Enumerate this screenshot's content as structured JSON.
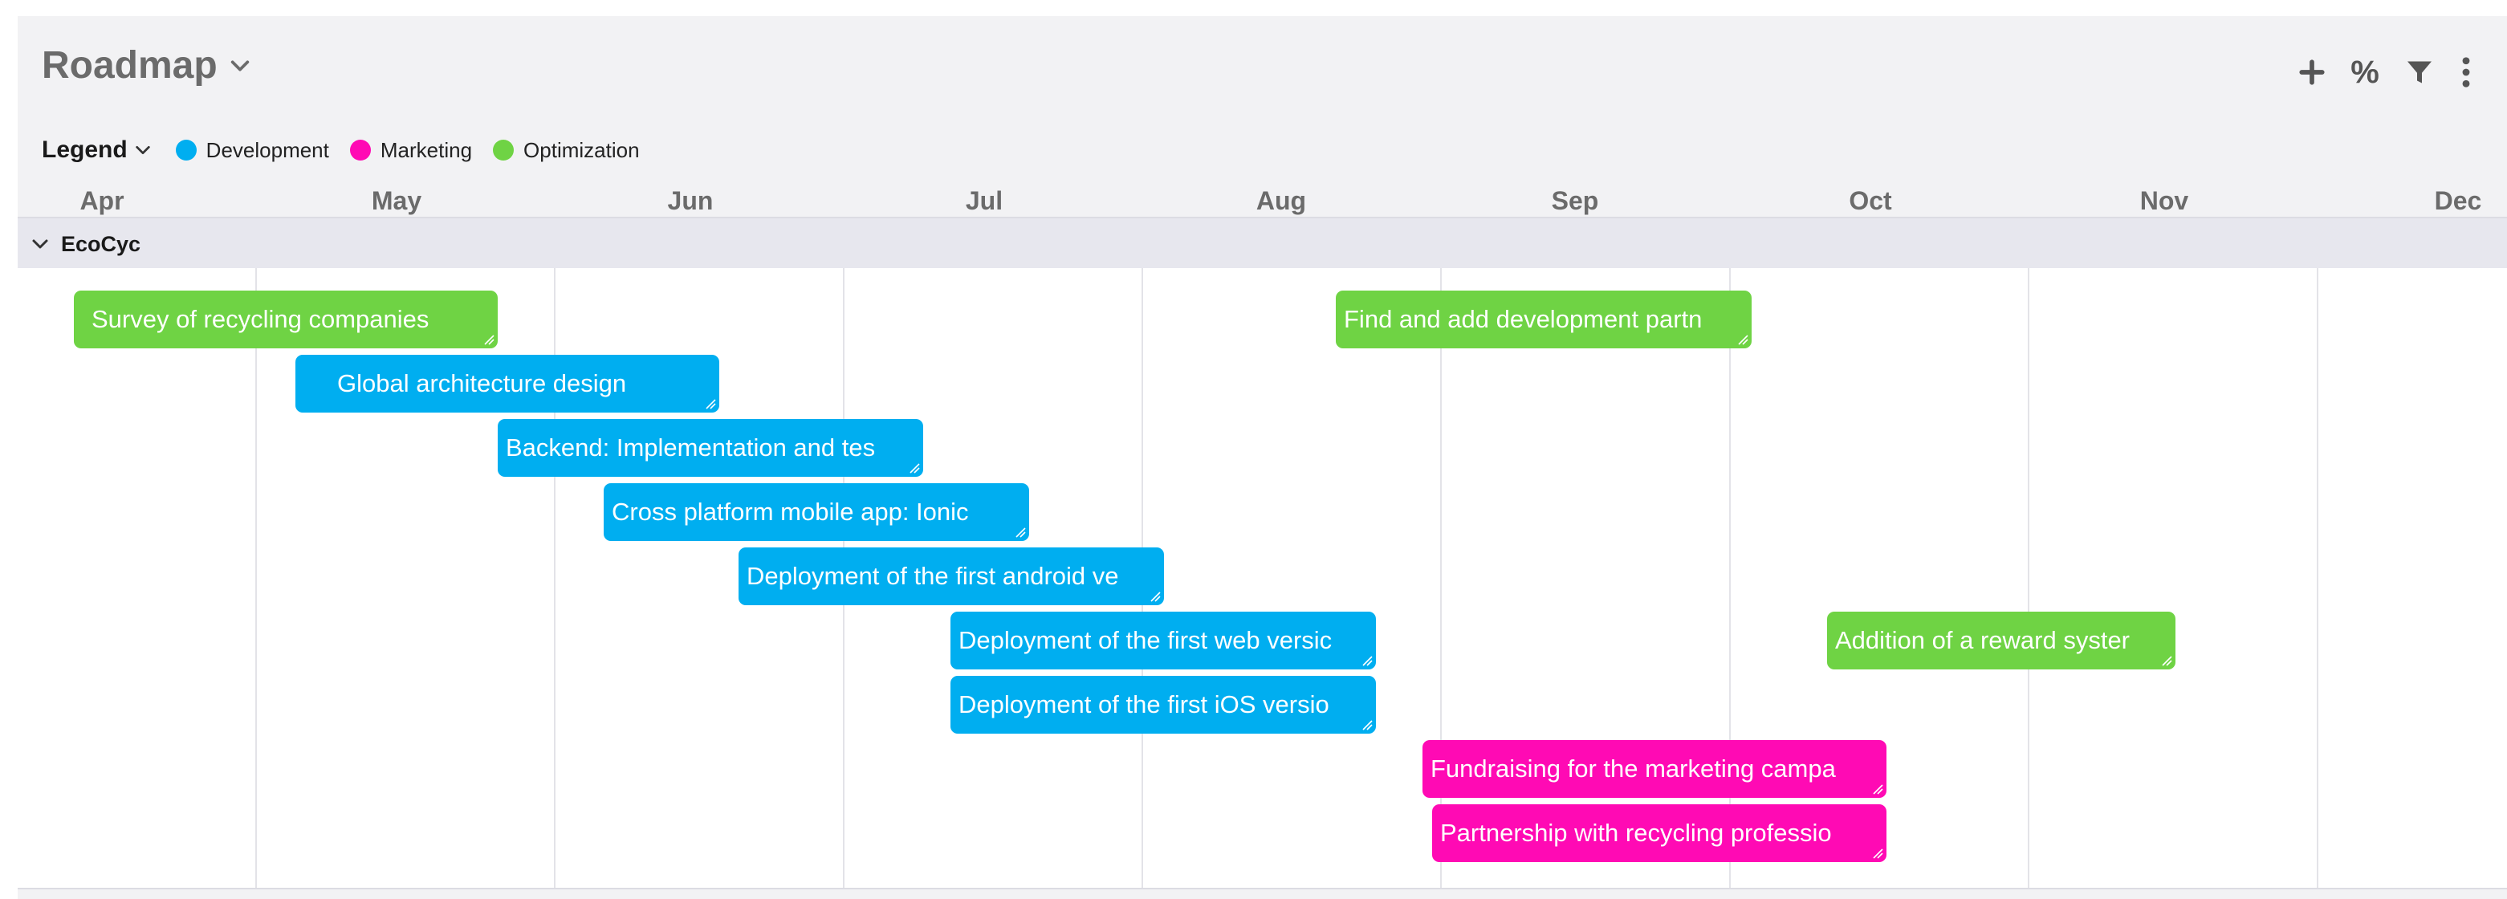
{
  "header": {
    "title": "Roadmap",
    "toolbar": {
      "add_icon": "plus-icon",
      "percent_label": "%",
      "filter_icon": "filter-icon",
      "more_icon": "more-vertical-icon"
    }
  },
  "legend": {
    "label": "Legend",
    "items": [
      {
        "label": "Development",
        "color": "#00aef0"
      },
      {
        "label": "Marketing",
        "color": "#ff0ab4"
      },
      {
        "label": "Optimization",
        "color": "#6fd344"
      }
    ]
  },
  "timeline": {
    "months": [
      "Apr",
      "May",
      "Jun",
      "Jul",
      "Aug",
      "Sep",
      "Oct",
      "Nov",
      "Dec"
    ]
  },
  "group": {
    "name": "EcoCyc",
    "tasks": [
      {
        "label": "Survey of recycling companies",
        "category": "Optimization"
      },
      {
        "label": "Global architecture design",
        "category": "Development"
      },
      {
        "label": "Backend: Implementation and tes",
        "category": "Development"
      },
      {
        "label": "Cross platform mobile app: Ionic",
        "category": "Development"
      },
      {
        "label": "Deployment of the first android ve",
        "category": "Development"
      },
      {
        "label": "Deployment of the first web versic",
        "category": "Development"
      },
      {
        "label": "Deployment of the first iOS versio",
        "category": "Development"
      },
      {
        "label": "Find and add development partn",
        "category": "Optimization"
      },
      {
        "label": "Addition of a reward syster",
        "category": "Optimization"
      },
      {
        "label": "Fundraising for the marketing campa",
        "category": "Marketing"
      },
      {
        "label": "Partnership with recycling professio",
        "category": "Marketing"
      }
    ]
  }
}
